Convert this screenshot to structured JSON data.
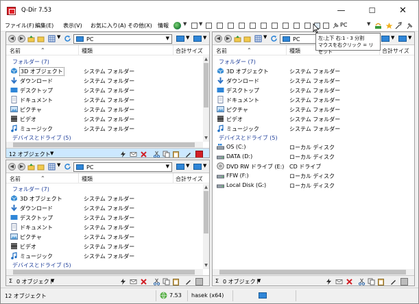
{
  "window": {
    "title": "Q-Dir 7.53"
  },
  "menu": {
    "items": [
      "ファイル(F)",
      "編集(E)",
      "表示(V)",
      "お気に入り(A)",
      "その他(X)",
      "情報"
    ],
    "location": "PC"
  },
  "tooltip": {
    "line1": "左:上下 右:1 - 3 分割",
    "line2": "マウスを右クリック = リセット"
  },
  "columns": {
    "name": "名前",
    "type": "種類",
    "size": "合計サイズ"
  },
  "groups": {
    "folders": "フォルダー (7)",
    "drives": "デバイスとドライブ (5)"
  },
  "folders": [
    {
      "name": "3D オブジェクト",
      "type": "システム フォルダー",
      "icon": "3d-objects-icon",
      "color": "#3a8fd6"
    },
    {
      "name": "ダウンロード",
      "type": "システム フォルダー",
      "icon": "download-icon",
      "color": "#2f74c6"
    },
    {
      "name": "デスクトップ",
      "type": "システム フォルダー",
      "icon": "desktop-icon",
      "color": "#2f86d8"
    },
    {
      "name": "ドキュメント",
      "type": "システム フォルダー",
      "icon": "document-icon",
      "color": "#7a8aa8"
    },
    {
      "name": "ピクチャ",
      "type": "システム フォルダー",
      "icon": "pictures-icon",
      "color": "#5aa0d8"
    },
    {
      "name": "ビデオ",
      "type": "システム フォルダー",
      "icon": "video-icon",
      "color": "#444444"
    },
    {
      "name": "ミュージック",
      "type": "システム フォルダー",
      "icon": "music-icon",
      "color": "#1f6fc4"
    }
  ],
  "drives": [
    {
      "name": "OS (C:)",
      "type": "ローカル ディスク",
      "icon": "windows-drive-icon"
    },
    {
      "name": "DATA (D:)",
      "type": "ローカル ディスク",
      "icon": "hard-drive-icon"
    },
    {
      "name": "DVD RW ドライブ (E:)",
      "type": "CD ドライブ",
      "icon": "dvd-drive-icon"
    },
    {
      "name": "FFW (F:)",
      "type": "ローカル ディスク",
      "icon": "hard-drive-icon"
    },
    {
      "name": "Local Disk (G:)",
      "type": "ローカル ディスク",
      "icon": "hard-drive-icon"
    }
  ],
  "panes": {
    "top_left": {
      "address": "PC",
      "status": "12 オブジェクト"
    },
    "bottom_left": {
      "address": "PC",
      "status": "0 オブジェクト"
    },
    "right": {
      "address": "PC",
      "status": "0 オブジェクト"
    }
  },
  "statusbar": {
    "count": "12 オブジェクト",
    "version": "7.53",
    "user": "hasek (x64)"
  },
  "colors": {
    "accent": "#2f86d8",
    "group_text": "#1e3e9a",
    "active_status": "#cce8ff",
    "close_red": "#d11f26"
  }
}
